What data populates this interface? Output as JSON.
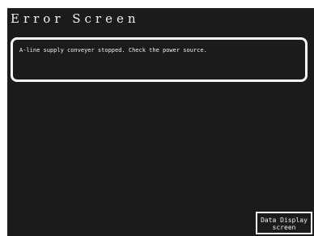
{
  "screen": {
    "title": "Error Screen",
    "message": "A-line supply conveyer stopped. Check the power source.",
    "data_display_button": {
      "line1": "Data Display",
      "line2": "screen"
    }
  },
  "colors": {
    "background": "#1b1b1b",
    "text": "#f2f2f2",
    "border": "#f4f4f4"
  }
}
